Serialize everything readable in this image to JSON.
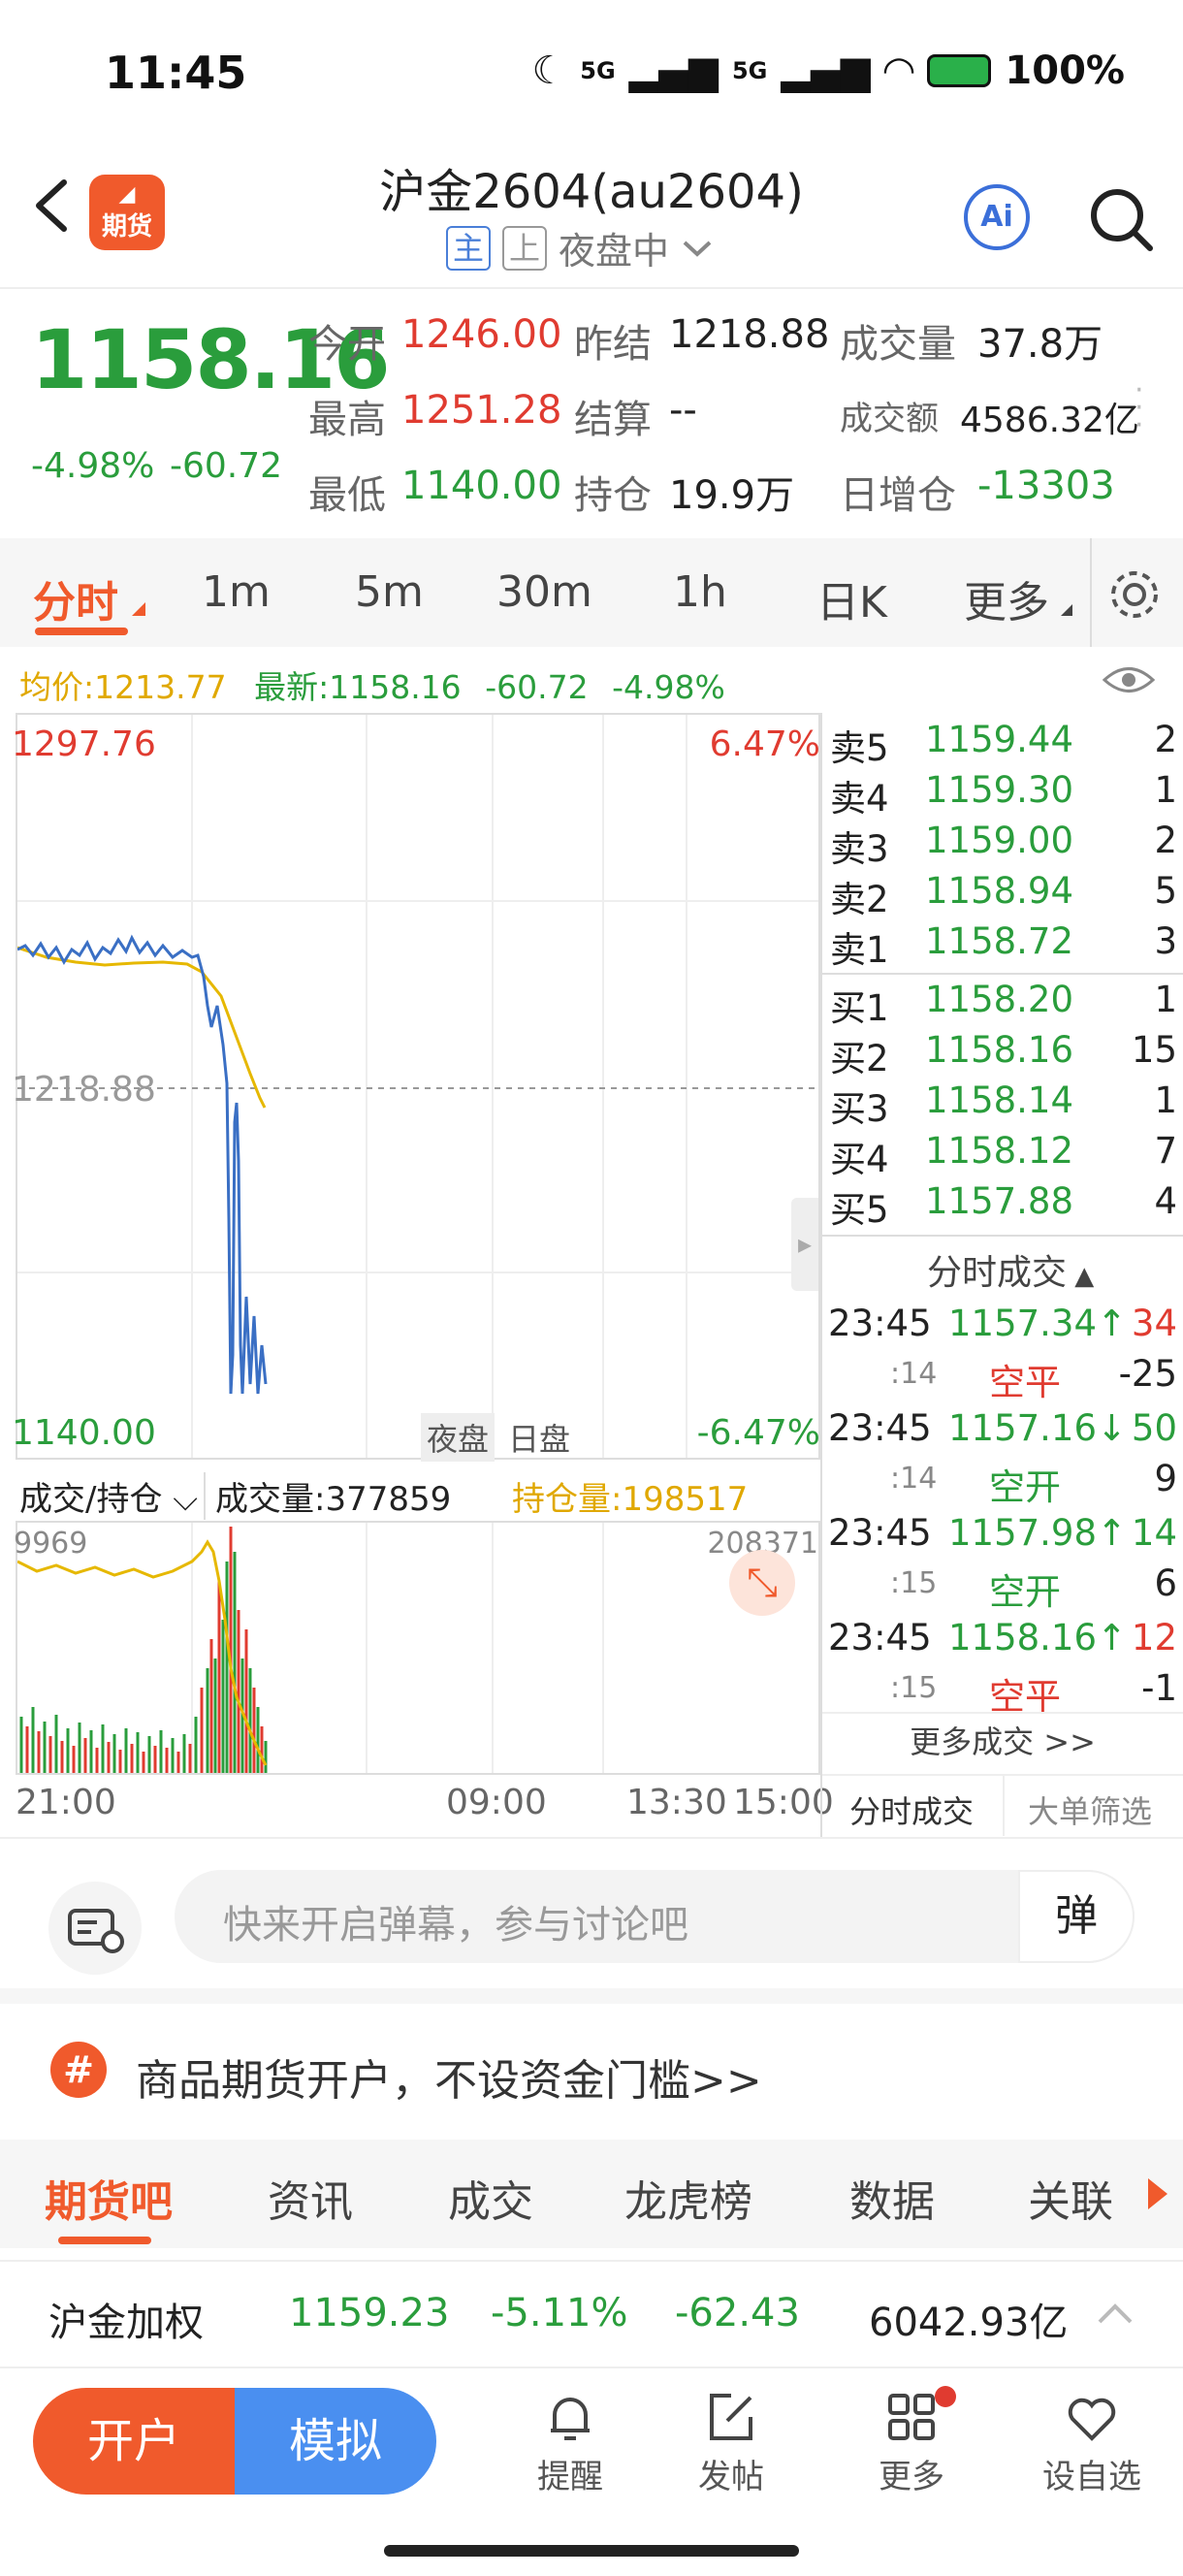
{
  "status": {
    "time": "11:45",
    "net1": "5G",
    "net2": "5G",
    "battery": "100%"
  },
  "header": {
    "title": "沪金2604(au2604)",
    "tag_main": "主",
    "tag_up": "上",
    "session": "夜盘中",
    "logo_text": "期货",
    "ai_label": "Ai"
  },
  "quote": {
    "price": "1158.16",
    "change_pct": "-4.98%",
    "change": "-60.72",
    "open_label": "今开",
    "open": "1246.00",
    "high_label": "最高",
    "high": "1251.28",
    "low_label": "最低",
    "low": "1140.00",
    "prev_settle_label": "昨结",
    "prev_settle": "1218.88",
    "settle_label": "结算",
    "settle": "--",
    "oi_label": "持仓",
    "oi": "19.9万",
    "volume_label": "成交量",
    "volume": "37.8万",
    "turnover_label": "成交额",
    "turnover": "4586.32亿",
    "oi_change_label": "日增仓",
    "oi_change": "-13303"
  },
  "ktabs": [
    "分时",
    "1m",
    "5m",
    "30m",
    "1h",
    "日K",
    "更多"
  ],
  "avg_bar": {
    "avg": "均价:1213.77",
    "latest": "最新:1158.16",
    "chg": "-60.72",
    "pct": "-4.98%"
  },
  "chart": {
    "y_high": "1297.76",
    "y_mid": "1218.88",
    "y_low": "1140.00",
    "pct_high": "6.47%",
    "pct_low": "-6.47%",
    "night": "夜盘",
    "day": "日盘"
  },
  "vol_header": {
    "selector": "成交/持仓",
    "volume": "成交量:377859",
    "oi": "持仓量:198517",
    "left_val": "9969",
    "right_val": "208371"
  },
  "x_axis": {
    "t1": "21:00",
    "t2": "09:00",
    "t3": "13:30",
    "t4": "15:00"
  },
  "orderbook": {
    "asks": [
      {
        "k": "卖5",
        "p": "1159.44",
        "v": "2"
      },
      {
        "k": "卖4",
        "p": "1159.30",
        "v": "1"
      },
      {
        "k": "卖3",
        "p": "1159.00",
        "v": "2"
      },
      {
        "k": "卖2",
        "p": "1158.94",
        "v": "5"
      },
      {
        "k": "卖1",
        "p": "1158.72",
        "v": "3"
      }
    ],
    "bids": [
      {
        "k": "买1",
        "p": "1158.20",
        "v": "1"
      },
      {
        "k": "买2",
        "p": "1158.16",
        "v": "15"
      },
      {
        "k": "买3",
        "p": "1158.14",
        "v": "1"
      },
      {
        "k": "买4",
        "p": "1158.12",
        "v": "7"
      },
      {
        "k": "买5",
        "p": "1157.88",
        "v": "4"
      }
    ]
  },
  "trades": {
    "header": "分时成交",
    "rows": [
      {
        "time": "23:45",
        "sec": ":14",
        "price": "1157.34↑",
        "vol": "34",
        "type": "空平",
        "oi": "-25"
      },
      {
        "time": "23:45",
        "sec": ":14",
        "price": "1157.16↓",
        "vol": "50",
        "type": "空开",
        "oi": "9"
      },
      {
        "time": "23:45",
        "sec": ":15",
        "price": "1157.98↑",
        "vol": "14",
        "type": "空开",
        "oi": "6"
      },
      {
        "time": "23:45",
        "sec": ":15",
        "price": "1158.16↑",
        "vol": "12",
        "type": "空平",
        "oi": "-1"
      }
    ],
    "more": "更多成交 >>",
    "tab1": "分时成交",
    "tab2": "大单筛选"
  },
  "comment": {
    "placeholder": "快来开启弹幕，参与讨论吧",
    "danmu": "弹"
  },
  "promo": {
    "text": "商品期货开户，不设资金门槛>>"
  },
  "bottom_tabs": [
    "期货吧",
    "资讯",
    "成交",
    "龙虎榜",
    "数据",
    "关联"
  ],
  "index_row": {
    "name": "沪金加权",
    "price": "1159.23",
    "pct": "-5.11%",
    "chg": "-62.43",
    "amount": "6042.93亿"
  },
  "nav": {
    "open": "开户",
    "sim": "模拟",
    "remind": "提醒",
    "post": "发帖",
    "more": "更多",
    "watch": "设自选"
  },
  "colors": {
    "up": "#e03b30",
    "down": "#2a9d3c",
    "accent": "#f05a2c",
    "blue": "#4a8ff0"
  }
}
